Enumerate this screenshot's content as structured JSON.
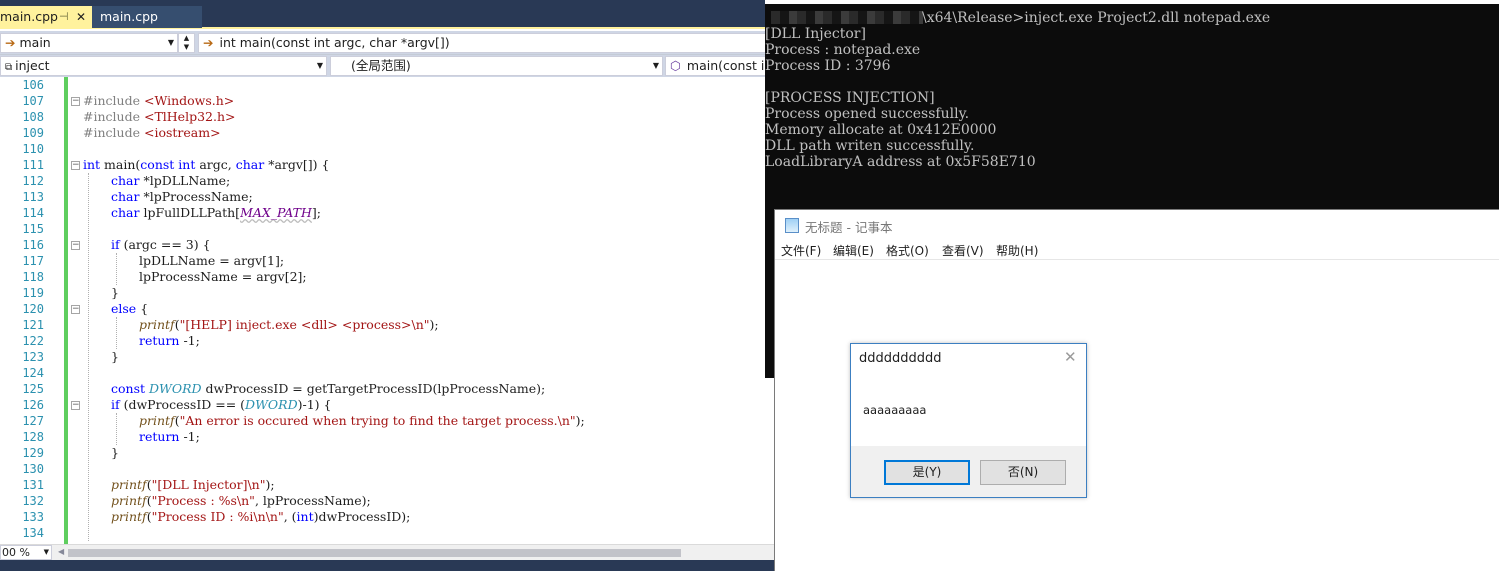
{
  "ide": {
    "tabs": [
      {
        "label": "main.cpp",
        "active": true,
        "pin_icon": "pin-icon",
        "close_icon": "close-icon"
      },
      {
        "label": "main.cpp",
        "active": false
      }
    ],
    "nav": {
      "scope_combo": "main",
      "function_combo": "int main(const int argc, char *argv[])",
      "project_combo": "inject",
      "global_scope_combo": "(全局范围)",
      "member_combo": "main(const int"
    },
    "zoom": "00 %",
    "line_numbers": [
      "106",
      "107",
      "108",
      "109",
      "110",
      "111",
      "112",
      "113",
      "114",
      "115",
      "116",
      "117",
      "118",
      "119",
      "120",
      "121",
      "122",
      "123",
      "124",
      "125",
      "126",
      "127",
      "128",
      "129",
      "130",
      "131",
      "132",
      "133",
      "134"
    ],
    "code_lines": [
      "",
      "#include <Windows.h>",
      "#include <TlHelp32.h>",
      "#include <iostream>",
      "",
      "int main(const int argc, char *argv[]) {",
      "char *lpDLLName;",
      "char *lpProcessName;",
      "char lpFullDLLPath[MAX_PATH];",
      "",
      "if (argc == 3) {",
      "lpDLLName = argv[1];",
      "lpProcessName = argv[2];",
      "}",
      "else {",
      "printf(\"[HELP] inject.exe <dll> <process>\\n\");",
      "return -1;",
      "}",
      "",
      "const DWORD dwProcessID = getTargetProcessID(lpProcessName);",
      "if (dwProcessID == (DWORD)-1) {",
      "printf(\"An error is occured when trying to find the target process.\\n\");",
      "return -1;",
      "}",
      "",
      "printf(\"[DLL Injector]\\n\");",
      "printf(\"Process : %s\\n\", lpProcessName);",
      "printf(\"Process ID : %i\\n\\n\", (int)dwProcessID);",
      ""
    ]
  },
  "console": {
    "command_line": "\\x64\\Release>inject.exe Project2.dll notepad.exe",
    "lines": [
      "[DLL Injector]",
      "Process : notepad.exe",
      "Process ID : 3796",
      "",
      "[PROCESS INJECTION]",
      "Process opened successfully.",
      "Memory allocate at 0x412E0000",
      "DLL path writen successfully.",
      "LoadLibraryA address at 0x5F58E710"
    ]
  },
  "notepad": {
    "title": "无标题 - 记事本",
    "menus": {
      "file": "文件(F)",
      "edit": "编辑(E)",
      "format": "格式(O)",
      "view": "查看(V)",
      "help": "帮助(H)"
    }
  },
  "messagebox": {
    "title": "dddddddddd",
    "message": "aaaaaaaaa",
    "yes_button": "是(Y)",
    "no_button": "否(N)"
  },
  "colors": {
    "vs_tab_active": "#fff29d",
    "vs_tabbar": "#293955",
    "line_number": "#2b91af",
    "keyword": "#0000ff",
    "string": "#a31515",
    "change_bar": "#5fce5f",
    "console_bg": "#0c0c0c",
    "console_text": "#c0c0c0",
    "default_button_border": "#0078d7"
  }
}
